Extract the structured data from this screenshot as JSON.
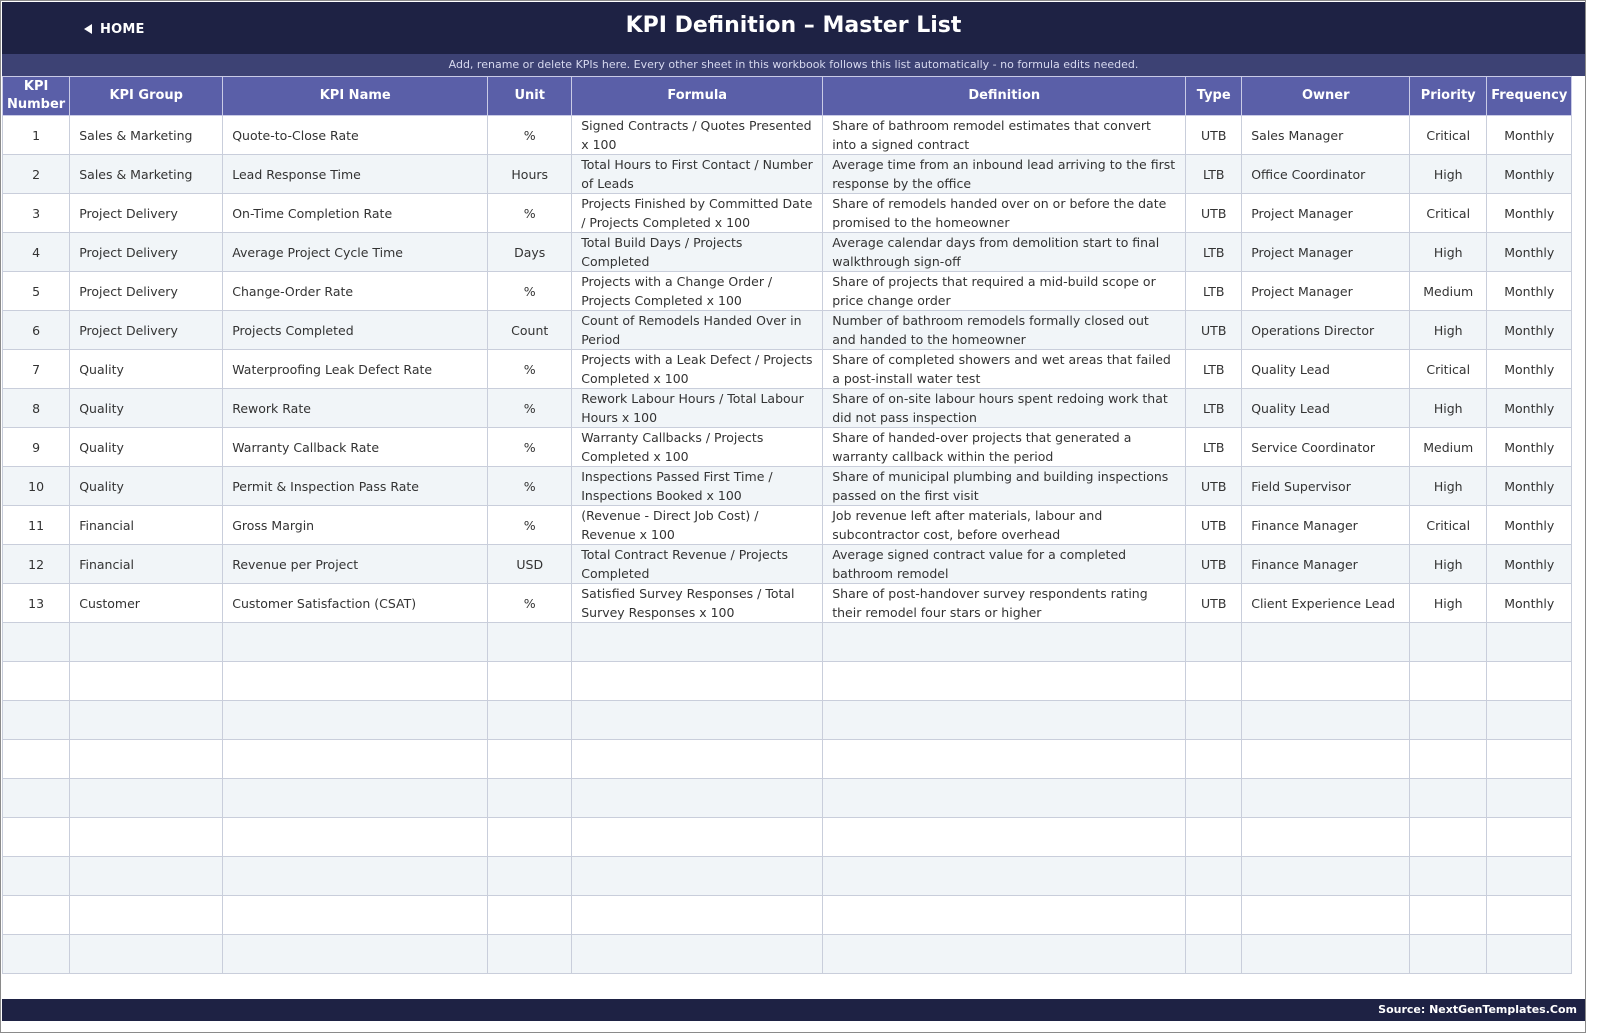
{
  "header": {
    "home_label": "HOME",
    "title": "KPI Definition  –  Master List",
    "subtitle": "Add, rename or delete KPIs here. Every other sheet in this workbook follows this list automatically - no formula edits needed."
  },
  "colors": {
    "title_bar": "#1e2244",
    "sub_bar": "#3d4274",
    "header_row": "#5a5fa8",
    "alt_row": "#f1f5f8",
    "footer_bar": "#1e2244"
  },
  "icons": {
    "home": "triangle-left-icon"
  },
  "table": {
    "columns": [
      "KPI Number",
      "KPI Group",
      "KPI Name",
      "Unit",
      "Formula",
      "Definition",
      "Type",
      "Owner",
      "Priority",
      "Frequency"
    ],
    "rows": [
      [
        "1",
        "Sales & Marketing",
        "Quote-to-Close Rate",
        "%",
        "Signed Contracts / Quotes Presented x 100",
        "Share of bathroom remodel estimates that convert into a signed contract",
        "UTB",
        "Sales Manager",
        "Critical",
        "Monthly"
      ],
      [
        "2",
        "Sales & Marketing",
        "Lead Response Time",
        "Hours",
        "Total Hours to First Contact / Number of Leads",
        "Average time from an inbound lead arriving to the first response by the office",
        "LTB",
        "Office Coordinator",
        "High",
        "Monthly"
      ],
      [
        "3",
        "Project Delivery",
        "On-Time Completion Rate",
        "%",
        "Projects Finished by Committed Date / Projects Completed x 100",
        "Share of remodels handed over on or before the date promised to the homeowner",
        "UTB",
        "Project Manager",
        "Critical",
        "Monthly"
      ],
      [
        "4",
        "Project Delivery",
        "Average Project Cycle Time",
        "Days",
        "Total Build Days / Projects Completed",
        "Average calendar days from demolition start to final walkthrough sign-off",
        "LTB",
        "Project Manager",
        "High",
        "Monthly"
      ],
      [
        "5",
        "Project Delivery",
        "Change-Order Rate",
        "%",
        "Projects with a Change Order / Projects Completed x 100",
        "Share of projects that required a mid-build scope or price change order",
        "LTB",
        "Project Manager",
        "Medium",
        "Monthly"
      ],
      [
        "6",
        "Project Delivery",
        "Projects Completed",
        "Count",
        "Count of Remodels Handed Over in Period",
        "Number of bathroom remodels formally closed out and handed to the homeowner",
        "UTB",
        "Operations Director",
        "High",
        "Monthly"
      ],
      [
        "7",
        "Quality",
        "Waterproofing Leak Defect Rate",
        "%",
        "Projects with a Leak Defect / Projects Completed x 100",
        "Share of completed showers and wet areas that failed a post-install water test",
        "LTB",
        "Quality Lead",
        "Critical",
        "Monthly"
      ],
      [
        "8",
        "Quality",
        "Rework Rate",
        "%",
        "Rework Labour Hours / Total Labour Hours x 100",
        "Share of on-site labour hours spent redoing work that did not pass inspection",
        "LTB",
        "Quality Lead",
        "High",
        "Monthly"
      ],
      [
        "9",
        "Quality",
        "Warranty Callback Rate",
        "%",
        "Warranty Callbacks / Projects Completed x 100",
        "Share of handed-over projects that generated a warranty callback within the period",
        "LTB",
        "Service Coordinator",
        "Medium",
        "Monthly"
      ],
      [
        "10",
        "Quality",
        "Permit & Inspection Pass Rate",
        "%",
        "Inspections Passed First Time / Inspections Booked x 100",
        "Share of municipal plumbing and building inspections passed on the first visit",
        "UTB",
        "Field Supervisor",
        "High",
        "Monthly"
      ],
      [
        "11",
        "Financial",
        "Gross Margin",
        "%",
        "(Revenue - Direct Job Cost) / Revenue x 100",
        "Job revenue left after materials, labour and subcontractor cost, before overhead",
        "UTB",
        "Finance Manager",
        "Critical",
        "Monthly"
      ],
      [
        "12",
        "Financial",
        "Revenue per Project",
        "USD",
        "Total Contract Revenue / Projects Completed",
        "Average signed contract value for a completed bathroom remodel",
        "UTB",
        "Finance Manager",
        "High",
        "Monthly"
      ],
      [
        "13",
        "Customer",
        "Customer Satisfaction (CSAT)",
        "%",
        "Satisfied Survey Responses / Total Survey Responses x 100",
        "Share of post-handover survey respondents rating their remodel four stars or higher",
        "UTB",
        "Client Experience Lead",
        "High",
        "Monthly"
      ]
    ],
    "empty_rows": 9
  },
  "footer": {
    "source": "Source: NextGenTemplates.Com"
  }
}
